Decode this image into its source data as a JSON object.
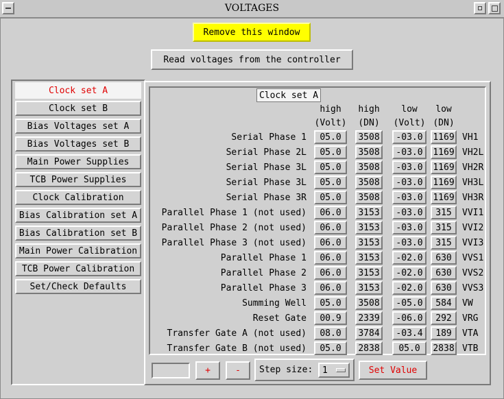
{
  "window": {
    "title": "VOLTAGES"
  },
  "buttons": {
    "remove": "Remove this window",
    "read": "Read voltages from the controller",
    "plus": "+",
    "minus": "-",
    "set_value": "Set Value"
  },
  "colors": {
    "remove_bg": "#ffff00",
    "red": "#e00000"
  },
  "tabs": [
    "Clock set A",
    "Clock set B",
    "Bias Voltages set A",
    "Bias Voltages set B",
    "Main Power Supplies",
    "TCB Power Supplies",
    "Clock Calibration",
    "Bias Calibration set A",
    "Bias Calibration set B",
    "Main Power Calibration",
    "TCB Power Calibration",
    "Set/Check Defaults"
  ],
  "active_tab": "Clock set A",
  "panel": {
    "title": "Clock set A",
    "headers": [
      {
        "l1": "high",
        "l2": "(Volt)"
      },
      {
        "l1": "high",
        "l2": "(DN)"
      },
      {
        "l1": "low",
        "l2": "(Volt)"
      },
      {
        "l1": "low",
        "l2": "(DN)"
      }
    ],
    "rows": [
      {
        "label": "Serial Phase 1",
        "high_volt": "05.0",
        "high_dn": "3508",
        "low_volt": "-03.0",
        "low_dn": "1169",
        "code": "VH1"
      },
      {
        "label": "Serial Phase 2L",
        "high_volt": "05.0",
        "high_dn": "3508",
        "low_volt": "-03.0",
        "low_dn": "1169",
        "code": "VH2L"
      },
      {
        "label": "Serial Phase 3L",
        "high_volt": "05.0",
        "high_dn": "3508",
        "low_volt": "-03.0",
        "low_dn": "1169",
        "code": "VH2R"
      },
      {
        "label": "Serial Phase 3L",
        "high_volt": "05.0",
        "high_dn": "3508",
        "low_volt": "-03.0",
        "low_dn": "1169",
        "code": "VH3L"
      },
      {
        "label": "Serial Phase 3R",
        "high_volt": "05.0",
        "high_dn": "3508",
        "low_volt": "-03.0",
        "low_dn": "1169",
        "code": "VH3R"
      },
      {
        "label": "Parallel Phase 1 (not used)",
        "high_volt": "06.0",
        "high_dn": "3153",
        "low_volt": "-03.0",
        "low_dn": "315",
        "code": "VVI1"
      },
      {
        "label": "Parallel Phase 2 (not used)",
        "high_volt": "06.0",
        "high_dn": "3153",
        "low_volt": "-03.0",
        "low_dn": "315",
        "code": "VVI2"
      },
      {
        "label": "Parallel Phase 3 (not used)",
        "high_volt": "06.0",
        "high_dn": "3153",
        "low_volt": "-03.0",
        "low_dn": "315",
        "code": "VVI3"
      },
      {
        "label": "Parallel Phase 1",
        "high_volt": "06.0",
        "high_dn": "3153",
        "low_volt": "-02.0",
        "low_dn": "630",
        "code": "VVS1"
      },
      {
        "label": "Parallel Phase 2",
        "high_volt": "06.0",
        "high_dn": "3153",
        "low_volt": "-02.0",
        "low_dn": "630",
        "code": "VVS2"
      },
      {
        "label": "Parallel Phase 3",
        "high_volt": "06.0",
        "high_dn": "3153",
        "low_volt": "-02.0",
        "low_dn": "630",
        "code": "VVS3"
      },
      {
        "label": "Summing Well",
        "high_volt": "05.0",
        "high_dn": "3508",
        "low_volt": "-05.0",
        "low_dn": "584",
        "code": "VW"
      },
      {
        "label": "Reset Gate",
        "high_volt": "00.9",
        "high_dn": "2339",
        "low_volt": "-06.0",
        "low_dn": "292",
        "code": "VRG"
      },
      {
        "label": "Transfer Gate A (not used)",
        "high_volt": "08.0",
        "high_dn": "3784",
        "low_volt": "-03.4",
        "low_dn": "189",
        "code": "VTA"
      },
      {
        "label": "Transfer Gate B (not used)",
        "high_volt": "05.0",
        "high_dn": "2838",
        "low_volt": "05.0",
        "low_dn": "2838",
        "code": "VTB"
      }
    ]
  },
  "step": {
    "label": "Step size:",
    "value": "1",
    "input_value": ""
  }
}
